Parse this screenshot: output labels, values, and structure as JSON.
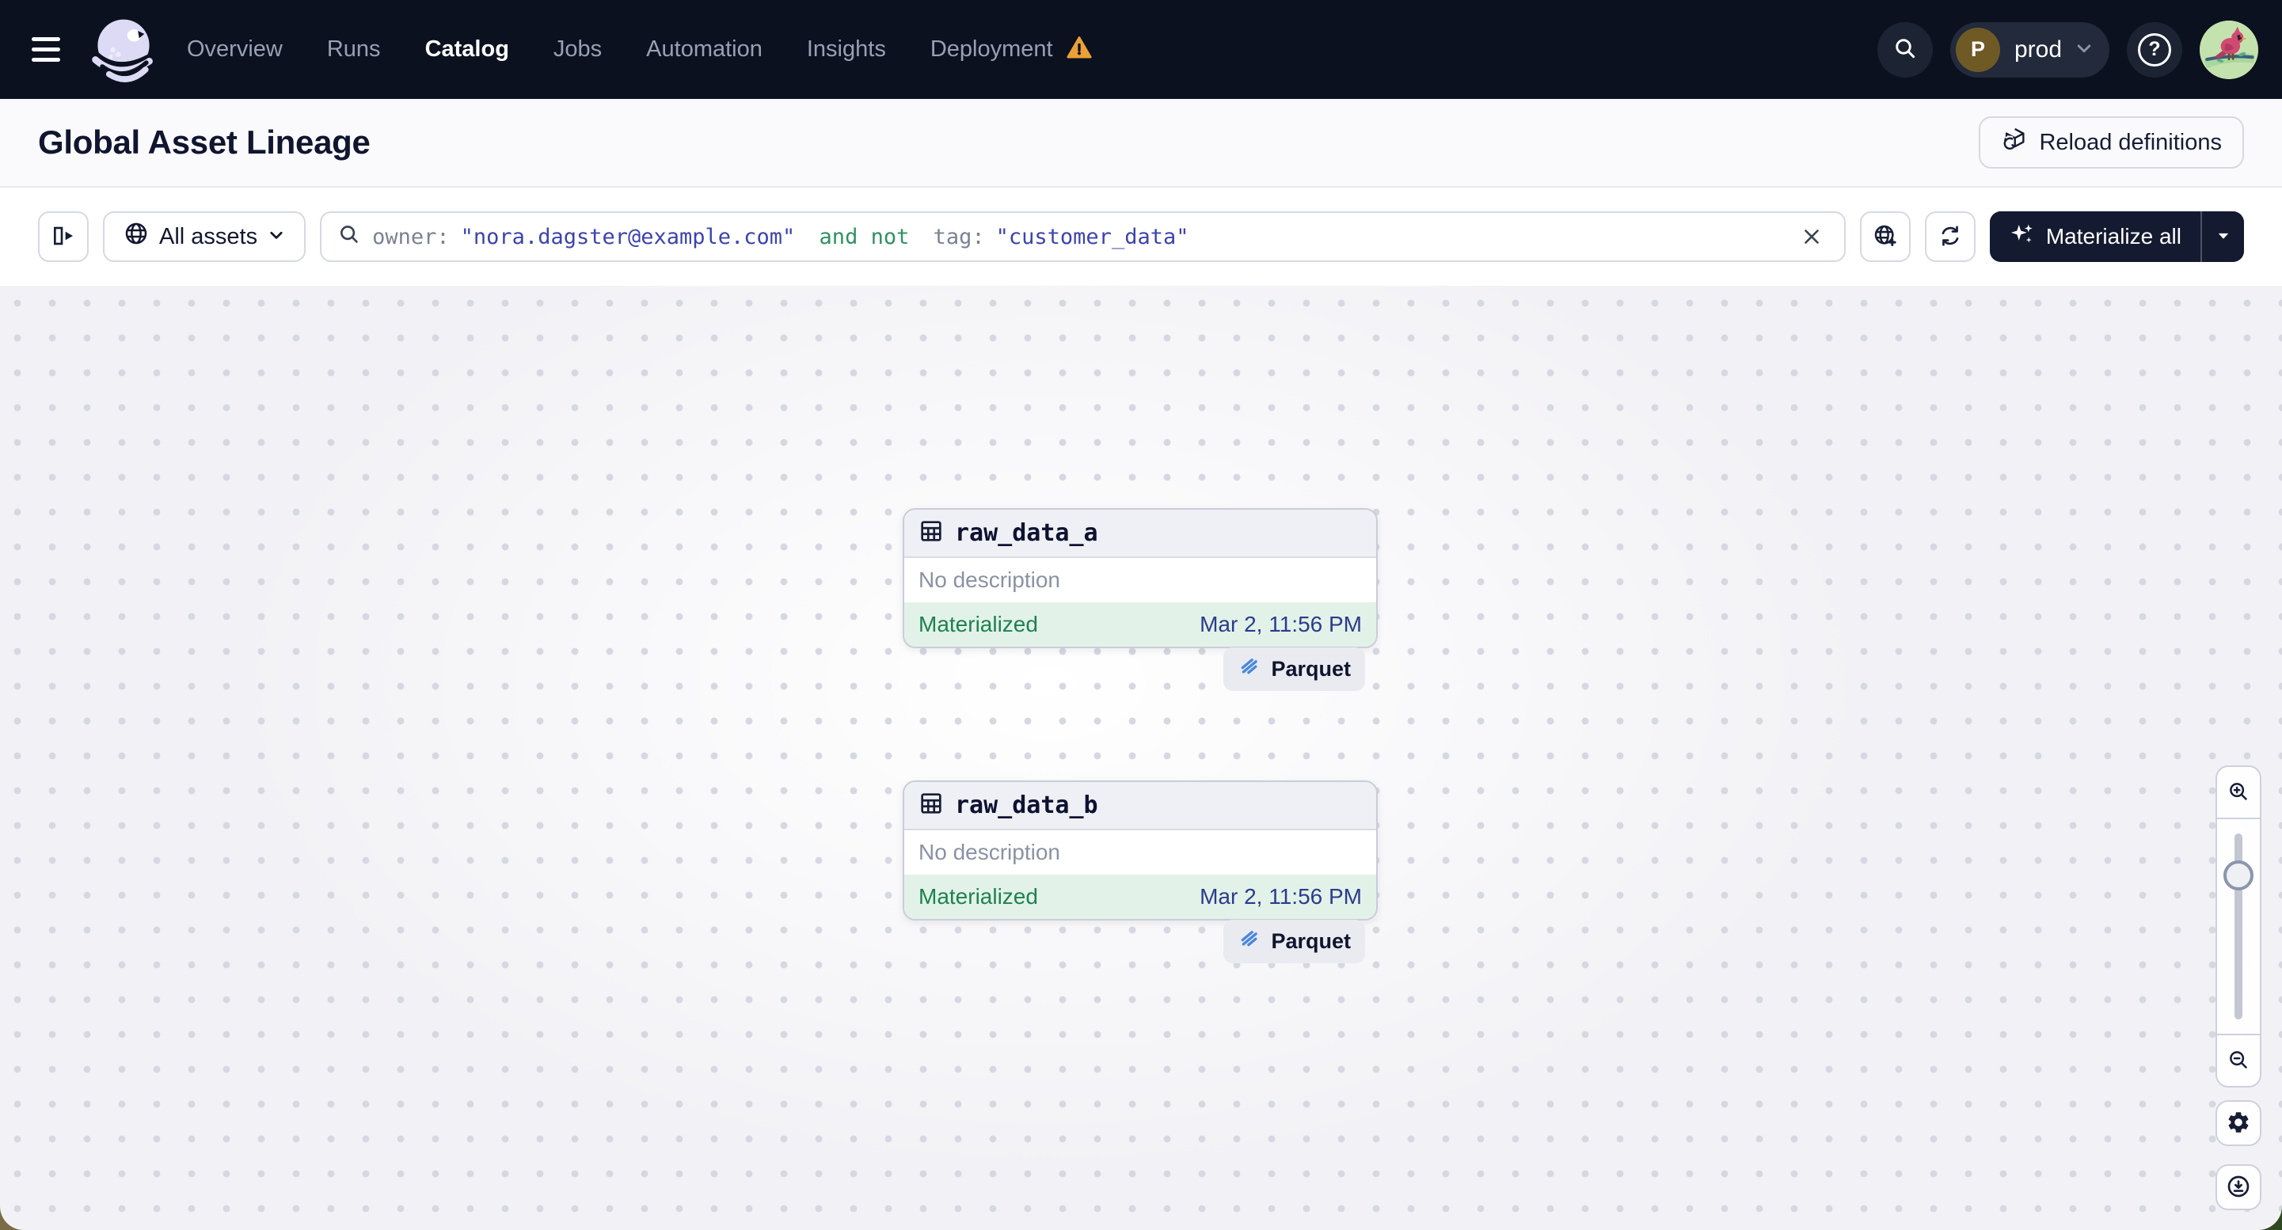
{
  "topnav": {
    "links": [
      {
        "label": "Overview"
      },
      {
        "label": "Runs"
      },
      {
        "label": "Catalog"
      },
      {
        "label": "Jobs"
      },
      {
        "label": "Automation"
      },
      {
        "label": "Insights"
      },
      {
        "label": "Deployment"
      }
    ],
    "active_link": "Catalog",
    "deployment_has_warning": true,
    "environment": {
      "label": "prod",
      "avatar_letter": "P"
    },
    "help_glyph": "?"
  },
  "header": {
    "title": "Global Asset Lineage",
    "reload_button_label": "Reload definitions"
  },
  "toolbar": {
    "scope_button_label": "All assets",
    "search": {
      "segments": [
        {
          "text": "owner:",
          "kind": "key"
        },
        {
          "text": "\"nora.dagster@example.com\"",
          "kind": "value"
        },
        {
          "text": " and not ",
          "kind": "operator"
        },
        {
          "text": "tag:",
          "kind": "key"
        },
        {
          "text": "\"customer_data\"",
          "kind": "value"
        }
      ]
    },
    "materialize_button_label": "Materialize all"
  },
  "canvas": {
    "nodes": [
      {
        "name": "raw_data_a",
        "description": "No description",
        "status": "Materialized",
        "materialized_at": "Mar 2, 11:56 PM",
        "badge": "Parquet"
      },
      {
        "name": "raw_data_b",
        "description": "No description",
        "status": "Materialized",
        "materialized_at": "Mar 2, 11:56 PM",
        "badge": "Parquet"
      }
    ]
  },
  "colors": {
    "topnav_bg": "#0c111f",
    "accent_dark": "#141a30",
    "status_green": "#1f8150",
    "status_green_bg": "#e2f2e8",
    "query_value": "#3d43ae",
    "query_operator": "#2f9161",
    "warning": "#eba135",
    "parquet_blue": "#4a87dd"
  }
}
